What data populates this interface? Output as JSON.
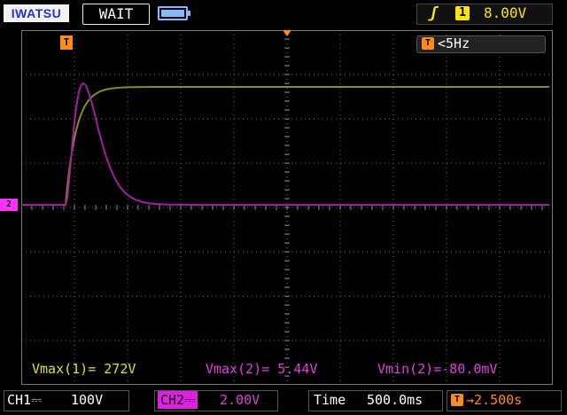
{
  "header": {
    "brand": "IWATSU",
    "run_state": "WAIT",
    "trigger_slope_icon": "rising-edge-icon",
    "trigger_source": "1",
    "trigger_level": "8.00V"
  },
  "display": {
    "trigger_position_icon": "T",
    "frequency": "<5Hz",
    "ch2_marker": "2",
    "colors": {
      "ch1": "#8c8c1e",
      "ch2": "#a020a0",
      "grid": "#6e6e6e",
      "trigger": "#ff8c1a"
    }
  },
  "measurements": [
    {
      "text": "Vmax(1)= 272V"
    },
    {
      "text": "Vmax(2)= 5.44V"
    },
    {
      "text": "Vmin(2)=-80.0mV"
    }
  ],
  "footer": {
    "ch1_label": "CH1⎓",
    "ch1_scale": "100V",
    "ch2_label": "CH2⎓",
    "ch2_scale": "2.00V",
    "time_label": "Time",
    "time_scale": "500.0ms",
    "delay_icon": "T",
    "delay": "→2.500s"
  }
}
